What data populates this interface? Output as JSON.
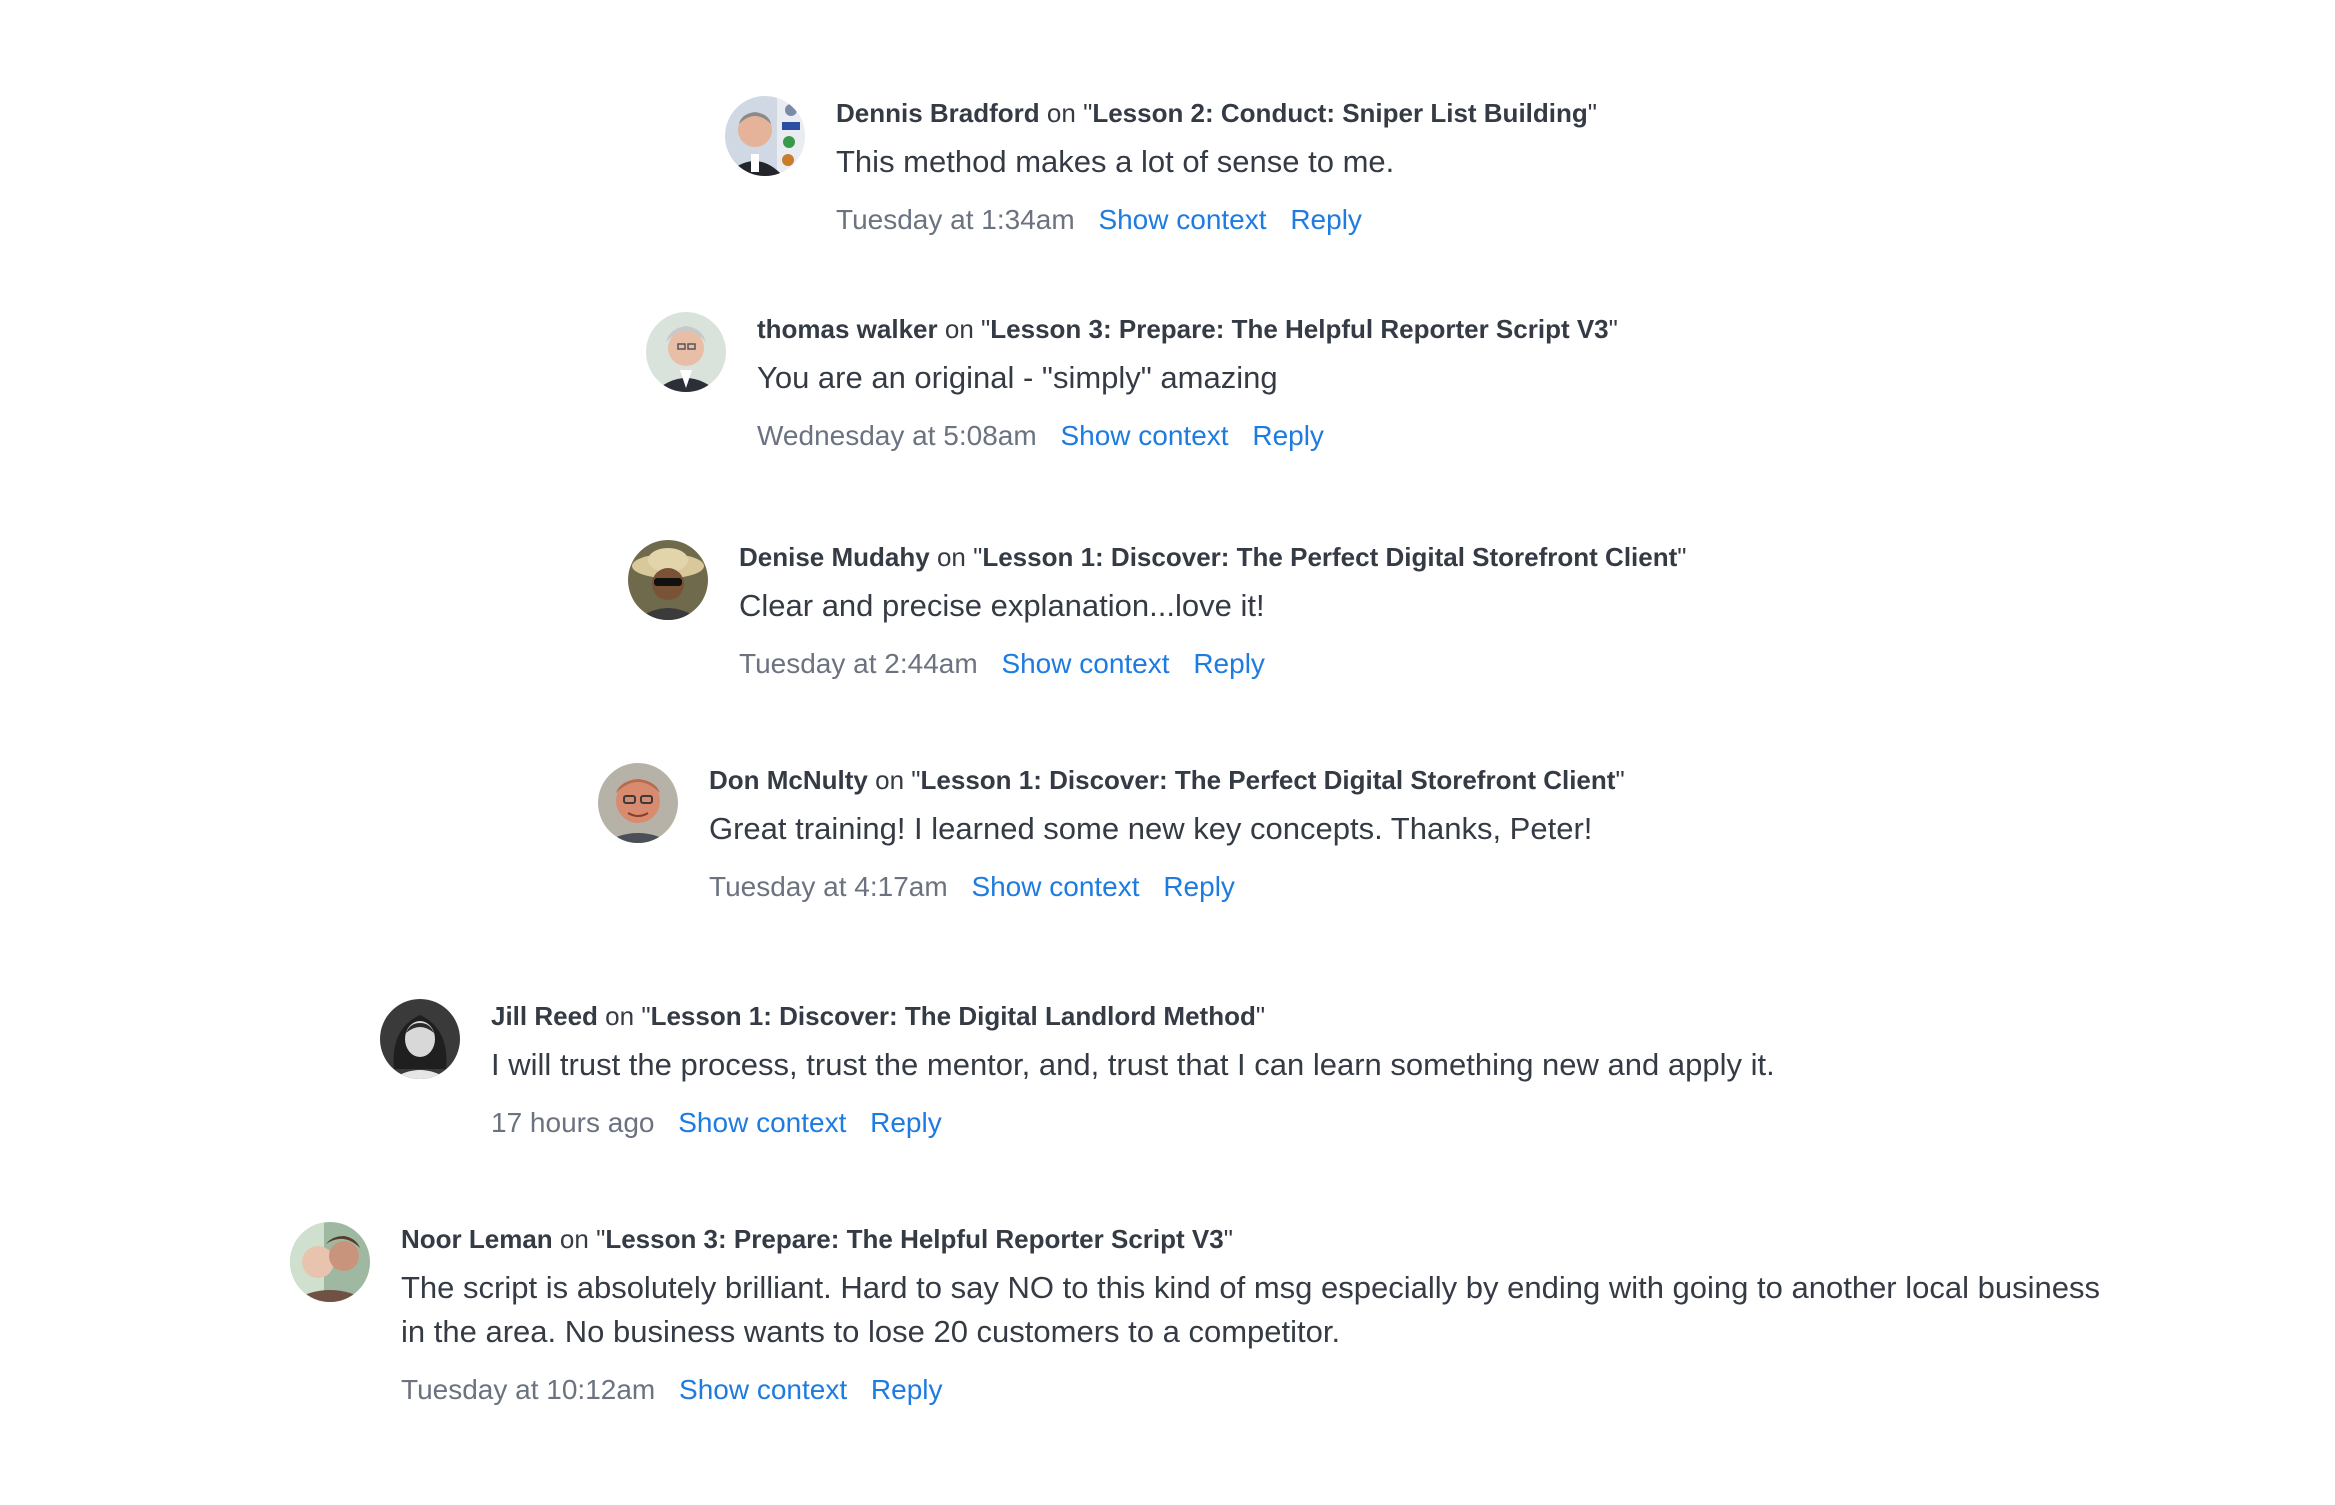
{
  "comments": [
    {
      "author": "Dennis Bradford",
      "on_text": "on",
      "lesson": "Lesson 2: Conduct: Sniper List Building",
      "text": "This method makes a lot of sense to me.",
      "time": "Tuesday at 1:34am",
      "show_context": "Show context",
      "reply": "Reply",
      "avatar_icon": "dennis-bradford-avatar"
    },
    {
      "author": "thomas walker",
      "on_text": "on",
      "lesson": "Lesson 3: Prepare: The Helpful Reporter Script V3",
      "text": "You are an original - \"simply\" amazing",
      "time": "Wednesday at 5:08am",
      "show_context": "Show context",
      "reply": "Reply",
      "avatar_icon": "thomas-walker-avatar"
    },
    {
      "author": "Denise Mudahy",
      "on_text": "on",
      "lesson": "Lesson 1: Discover: The Perfect Digital Storefront Client",
      "text": "Clear and precise explanation...love it!",
      "time": "Tuesday at 2:44am",
      "show_context": "Show context",
      "reply": "Reply",
      "avatar_icon": "denise-mudahy-avatar"
    },
    {
      "author": "Don McNulty",
      "on_text": "on",
      "lesson": "Lesson 1: Discover: The Perfect Digital Storefront Client",
      "text": "Great training! I learned some new key concepts. Thanks, Peter!",
      "time": "Tuesday at 4:17am",
      "show_context": "Show context",
      "reply": "Reply",
      "avatar_icon": "don-mcnulty-avatar"
    },
    {
      "author": "Jill Reed",
      "on_text": "on",
      "lesson": "Lesson 1: Discover: The Digital Landlord Method",
      "text": "I will trust the process, trust the mentor, and, trust that I can learn something new and apply it.",
      "time": "17 hours ago",
      "show_context": "Show context",
      "reply": "Reply",
      "avatar_icon": "jill-reed-avatar"
    },
    {
      "author": "Noor Leman",
      "on_text": "on",
      "lesson": "Lesson 3: Prepare: The Helpful Reporter Script V3",
      "text": "The script is absolutely brilliant. Hard to say NO to this kind of msg especially by ending with going to another local business in the area. No business wants to lose 20 customers to a competitor.",
      "time": "Tuesday at 10:12am",
      "show_context": "Show context",
      "reply": "Reply",
      "avatar_icon": "noor-leman-avatar"
    }
  ],
  "colors": {
    "link": "#1e7be0",
    "text": "#353b45",
    "muted": "#6b7280"
  }
}
